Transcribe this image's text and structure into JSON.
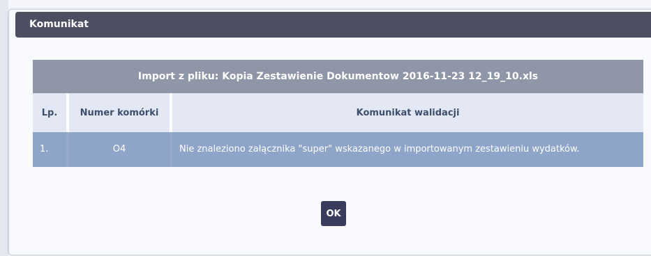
{
  "dialog": {
    "title": "Komunikat",
    "table": {
      "caption": "Import z pliku: Kopia Zestawienie Dokumentow 2016-11-23 12_19_10.xls",
      "columns": [
        "Lp.",
        "Numer komórki",
        "Komunikat walidacji"
      ],
      "rows": [
        {
          "lp": "1.",
          "cell": "O4",
          "message": "Nie znaleziono załącznika \"super\" wskazanego w importowanym zestawieniu wydatków."
        }
      ]
    },
    "ok_label": "OK"
  },
  "colors": {
    "header_bg": "#4e4e62",
    "caption_bg": "#8f96a7",
    "column_header_bg": "#e4e8f4",
    "row_bg": "#8fa4c9",
    "button_bg": "#3a3c5e"
  }
}
